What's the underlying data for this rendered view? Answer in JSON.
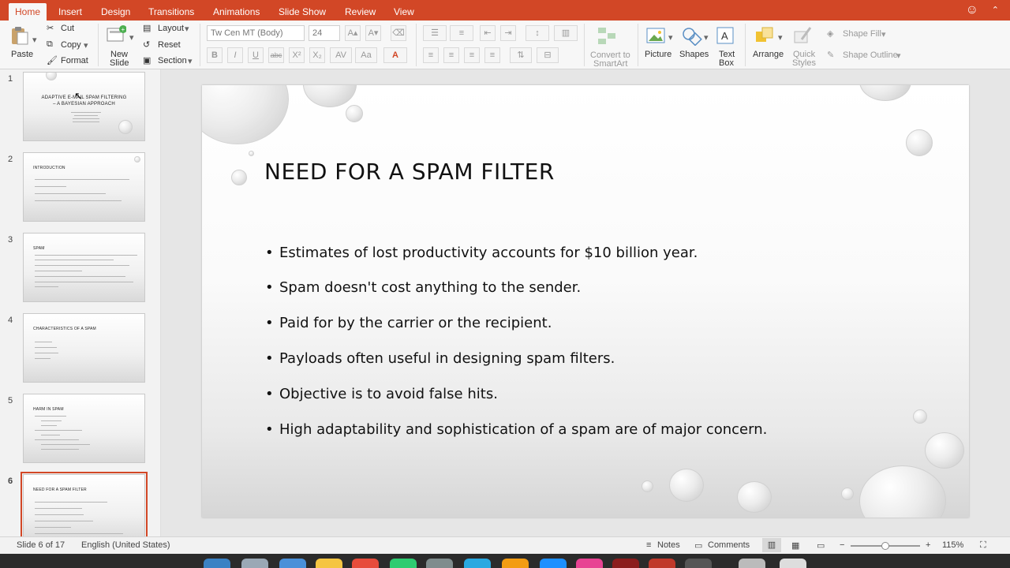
{
  "colors": {
    "accent": "#d24726",
    "ribbon_bg": "#f7f7f7",
    "slide_bg": "#ffffff"
  },
  "tabs": [
    "Home",
    "Insert",
    "Design",
    "Transitions",
    "Animations",
    "Slide Show",
    "Review",
    "View"
  ],
  "active_tab": "Home",
  "ribbon": {
    "paste": "Paste",
    "cut": "Cut",
    "copy": "Copy",
    "format": "Format",
    "new_slide": "New\nSlide",
    "new_slide_line1": "New",
    "new_slide_line2": "Slide",
    "layout": "Layout",
    "reset": "Reset",
    "section": "Section",
    "font_name": "Tw Cen MT (Body)",
    "font_size": "24",
    "convert_smartart_line1": "Convert to",
    "convert_smartart_line2": "SmartArt",
    "picture": "Picture",
    "shapes": "Shapes",
    "text_box_line1": "Text",
    "text_box_line2": "Box",
    "arrange": "Arrange",
    "quick_styles_line1": "Quick",
    "quick_styles_line2": "Styles",
    "shape_fill": "Shape Fill",
    "shape_outline": "Shape Outline"
  },
  "thumbnails": [
    {
      "num": "1",
      "title": "ADAPTIVE E-MAIL SPAM FILTERING – A BAYESIAN APPROACH",
      "lines": 4
    },
    {
      "num": "2",
      "title": "INTRODUCTION",
      "lines": 4
    },
    {
      "num": "3",
      "title": "SPAM",
      "lines": 7
    },
    {
      "num": "4",
      "title": "CHARACTERISTICS OF A SPAM",
      "lines": 4
    },
    {
      "num": "5",
      "title": "HARM IN SPAM",
      "lines": 8
    },
    {
      "num": "6",
      "title": "NEED FOR A SPAM FILTER",
      "lines": 6
    }
  ],
  "slide": {
    "title": "NEED FOR A SPAM FILTER",
    "bullets": [
      "Estimates of lost productivity accounts for $10 billion year.",
      "Spam doesn't cost anything to the sender.",
      "Paid for by the carrier or the recipient.",
      "Payloads often useful in designing spam filters.",
      "Objective is to avoid false hits.",
      "High adaptability and sophistication of a spam are of major concern."
    ]
  },
  "status": {
    "slide_info": "Slide 6 of 17",
    "language": "English (United States)",
    "notes": "Notes",
    "comments": "Comments",
    "zoom": "115%",
    "zoom_level": 0.5
  }
}
